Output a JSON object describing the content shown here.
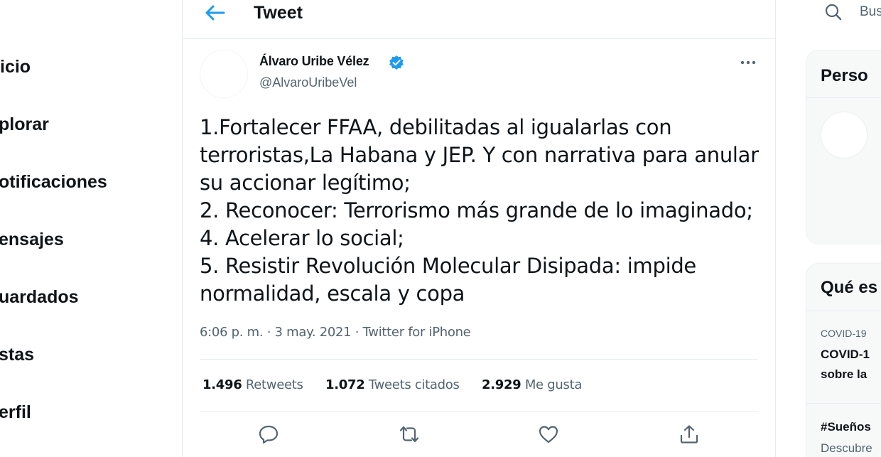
{
  "nav": {
    "items": [
      {
        "label": "icio"
      },
      {
        "label": "plorar"
      },
      {
        "label": "otificaciones"
      },
      {
        "label": "ensajes"
      },
      {
        "label": "uardados"
      },
      {
        "label": "stas"
      },
      {
        "label": "erfil"
      }
    ]
  },
  "header": {
    "title": "Tweet"
  },
  "tweet": {
    "author_name": "Álvaro Uribe Vélez",
    "handle": "@AlvaroUribeVel",
    "text_lines": [
      "1.Fortalecer FFAA, debilitadas al igualarlas con",
      "terroristas,La Habana y JEP. Y con narrativa para anular",
      "su accionar legítimo;",
      "2. Reconocer: Terrorismo más grande de lo imaginado;",
      "4. Acelerar lo social;",
      "5. Resistir Revolución Molecular Disipada: impide",
      "normalidad, escala y copa"
    ],
    "meta": "6:06 p. m. · 3 may. 2021 · Twitter for iPhone",
    "stats": {
      "retweets_count": "1.496",
      "retweets_label": "Retweets",
      "quotes_count": "1.072",
      "quotes_label": "Tweets citados",
      "likes_count": "2.929",
      "likes_label": "Me gusta"
    },
    "actions": [
      "reply-icon",
      "retweet-icon",
      "like-icon",
      "share-icon"
    ]
  },
  "sidebar": {
    "search_placeholder": "Bus",
    "who_to_follow_title": "Perso",
    "trends_title": "Qué es",
    "trends": [
      {
        "category": "COVID-19",
        "title_line1": "COVID-1",
        "title_line2": "sobre la"
      },
      {
        "title": "#Sueños",
        "subtitle": "Descubre"
      }
    ]
  },
  "colors": {
    "accent": "#1d9bf0",
    "text": "#0f1419",
    "muted": "#536471",
    "border": "#e6ecf0"
  }
}
